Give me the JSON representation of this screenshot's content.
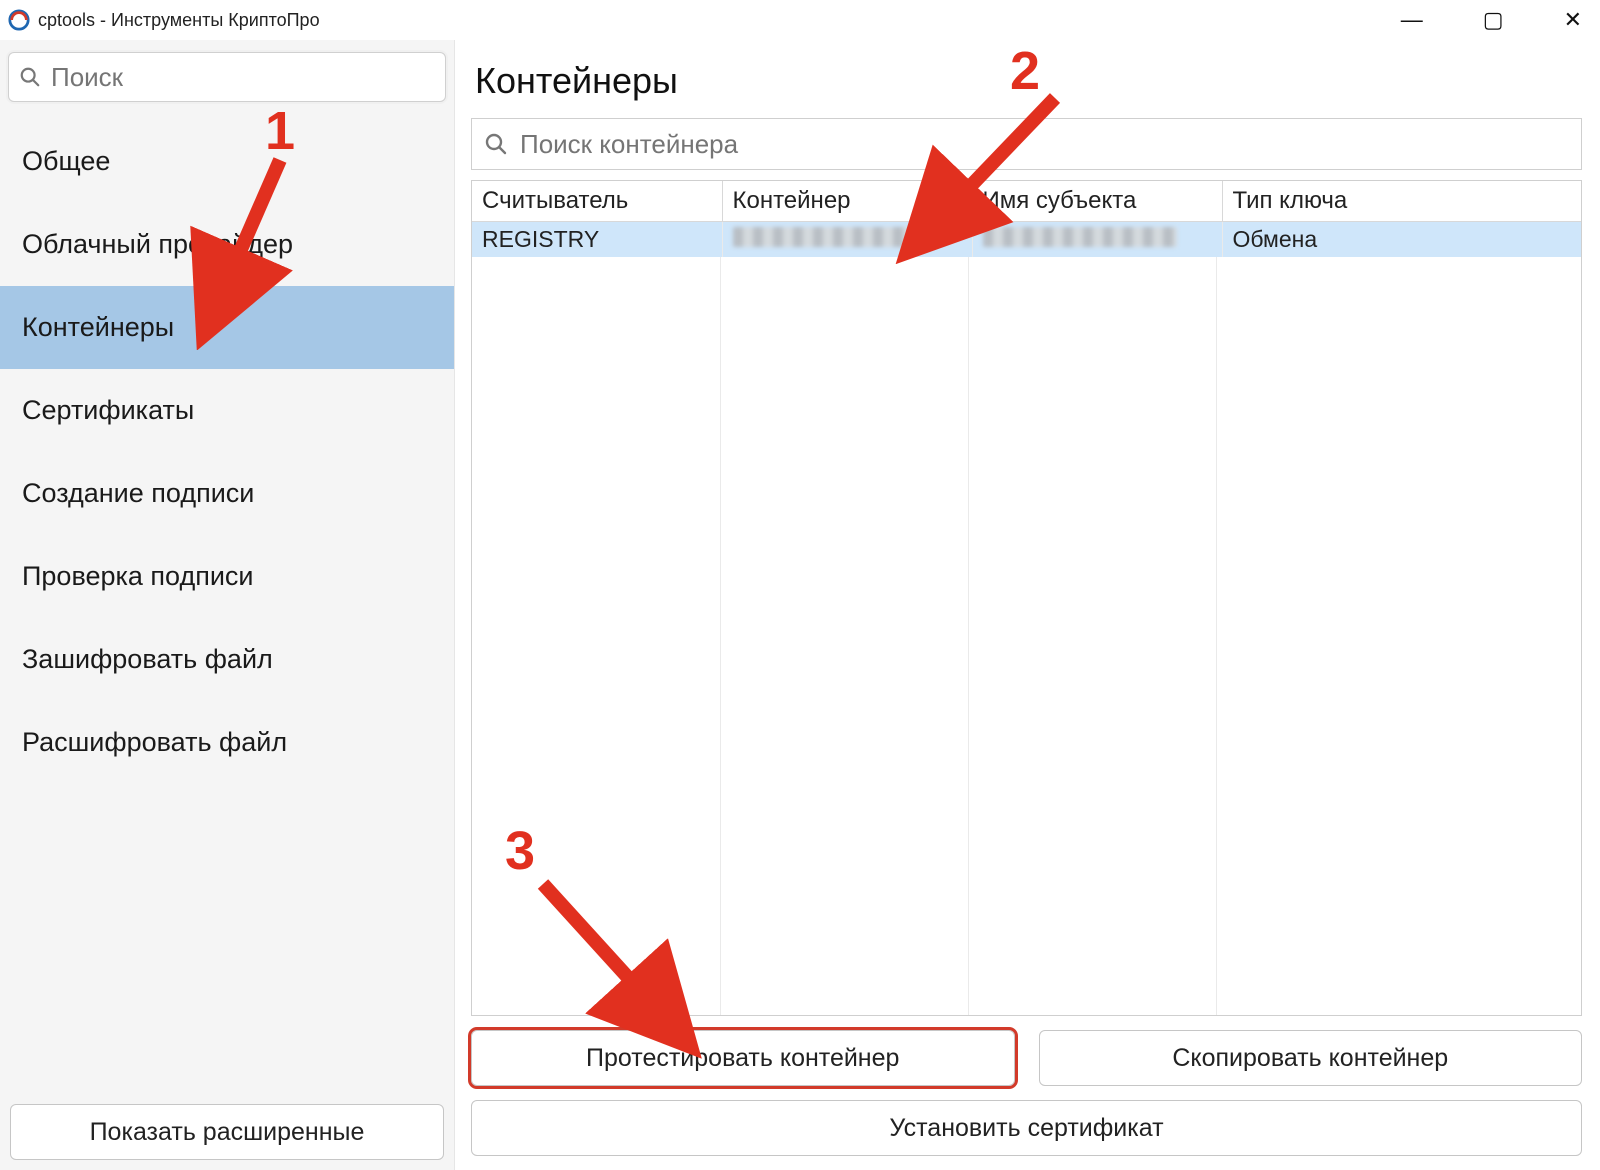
{
  "window": {
    "title": "cptools - Инструменты КриптоПро"
  },
  "sidebar": {
    "search_placeholder": "Поиск",
    "items": [
      {
        "label": "Общее"
      },
      {
        "label": "Облачный провайдер"
      },
      {
        "label": "Контейнеры"
      },
      {
        "label": "Сертификаты"
      },
      {
        "label": "Создание подписи"
      },
      {
        "label": "Проверка подписи"
      },
      {
        "label": "Зашифровать файл"
      },
      {
        "label": "Расшифровать файл"
      }
    ],
    "active_index": 2,
    "show_extended_label": "Показать расширенные"
  },
  "main": {
    "title": "Контейнеры",
    "search_placeholder": "Поиск контейнера",
    "columns": [
      "Считыватель",
      "Контейнер",
      "Имя субъекта",
      "Тип ключа"
    ],
    "rows": [
      {
        "reader": "REGISTRY",
        "container": "████████",
        "subject": "████████",
        "key_type": "Обмена"
      }
    ],
    "buttons": {
      "test": "Протестировать контейнер",
      "copy": "Скопировать контейнер",
      "install": "Установить сертификат"
    }
  },
  "annotations": {
    "step1": "1",
    "step2": "2",
    "step3": "3"
  },
  "colors": {
    "sidebar_bg": "#f5f5f5",
    "active_nav": "#a5c7e6",
    "row_selected": "#cfe6fa",
    "highlight": "#d23a2a",
    "annotation": "#e1301f"
  }
}
